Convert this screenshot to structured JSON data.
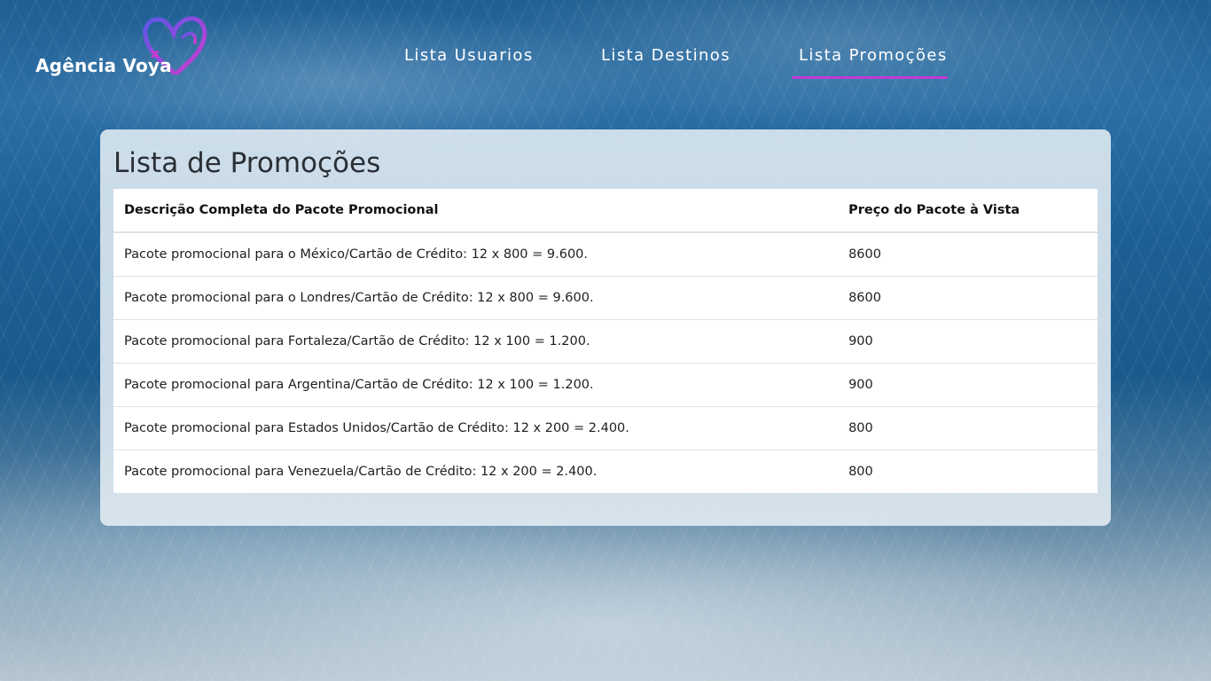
{
  "brand": {
    "name": "Agência Voya",
    "heart_color": "#c33ad6",
    "heart_color_secondary": "#6a4de6"
  },
  "nav": {
    "items": [
      {
        "label": "Lista Usuarios"
      },
      {
        "label": "Lista Destinos"
      },
      {
        "label": "Lista Promoções"
      }
    ],
    "active_index": 2,
    "active_color": "#c33ad6"
  },
  "page": {
    "title": "Lista de Promoções"
  },
  "table": {
    "headers": [
      "Descrição Completa do Pacote Promocional",
      "Preço do Pacote à Vista"
    ],
    "rows": [
      {
        "description": "Pacote promocional para o México/Cartão de Crédito: 12 x 800 = 9.600.",
        "price": "8600"
      },
      {
        "description": "Pacote promocional para o Londres/Cartão de Crédito: 12 x 800 = 9.600.",
        "price": "8600"
      },
      {
        "description": "Pacote promocional para Fortaleza/Cartão de Crédito: 12 x 100 = 1.200.",
        "price": "900"
      },
      {
        "description": "Pacote promocional para Argentina/Cartão de Crédito: 12 x 100 = 1.200.",
        "price": "900"
      },
      {
        "description": "Pacote promocional para Estados Unidos/Cartão de Crédito: 12 x 200 = 2.400.",
        "price": "800"
      },
      {
        "description": "Pacote promocional para Venezuela/Cartão de Crédito: 12 x 200 = 2.400.",
        "price": "800"
      }
    ]
  }
}
